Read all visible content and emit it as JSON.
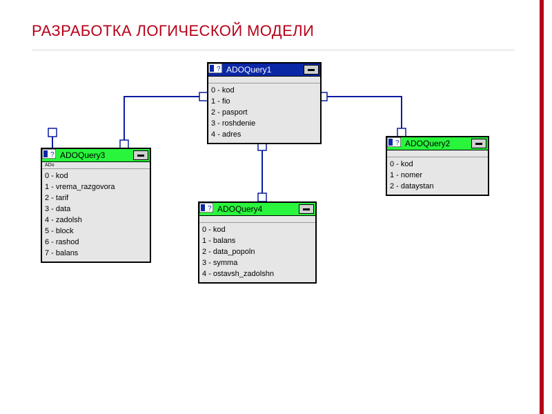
{
  "header": {
    "title": "РАЗРАБОТКА ЛОГИЧЕСКОЙ МОДЕЛИ"
  },
  "colors": {
    "accent": "#b60019",
    "header_blue": "#0a27a6",
    "header_green": "#29f53d"
  },
  "tables": {
    "q1": {
      "title": "ADOQuery1",
      "sublabel": "",
      "header_style": "blue",
      "fields": [
        {
          "index": "0",
          "name": "kod"
        },
        {
          "index": "1",
          "name": "fio"
        },
        {
          "index": "2",
          "name": "pasport"
        },
        {
          "index": "3",
          "name": "roshdenie"
        },
        {
          "index": "4",
          "name": "adres"
        }
      ]
    },
    "q2": {
      "title": "ADOQuery2",
      "sublabel": "",
      "header_style": "green",
      "fields": [
        {
          "index": "0",
          "name": "kod"
        },
        {
          "index": "1",
          "name": "nomer"
        },
        {
          "index": "2",
          "name": "dataystan"
        }
      ]
    },
    "q3": {
      "title": "ADOQuery3",
      "sublabel": "ADo",
      "header_style": "green",
      "fields": [
        {
          "index": "0",
          "name": "kod"
        },
        {
          "index": "1",
          "name": "vrema_razgovora"
        },
        {
          "index": "2",
          "name": "tarif"
        },
        {
          "index": "3",
          "name": "data"
        },
        {
          "index": "4",
          "name": "zadolsh"
        },
        {
          "index": "5",
          "name": "block"
        },
        {
          "index": "6",
          "name": "rashod"
        },
        {
          "index": "7",
          "name": "balans"
        }
      ]
    },
    "q4": {
      "title": "ADOQuery4",
      "sublabel": "",
      "header_style": "green",
      "fields": [
        {
          "index": "0",
          "name": "kod"
        },
        {
          "index": "1",
          "name": "balans"
        },
        {
          "index": "2",
          "name": "data_popoln"
        },
        {
          "index": "3",
          "name": "symma"
        },
        {
          "index": "4",
          "name": "ostavsh_zadolshn"
        }
      ]
    }
  },
  "chart_data": {
    "type": "table",
    "description": "ER-style logical data model diagram with four ADOQuery tables and 1-to-many style relations",
    "entities": [
      {
        "id": "ADOQuery1",
        "fields": [
          "kod",
          "fio",
          "pasport",
          "roshdenie",
          "adres"
        ]
      },
      {
        "id": "ADOQuery2",
        "fields": [
          "kod",
          "nomer",
          "dataystan"
        ]
      },
      {
        "id": "ADOQuery3",
        "fields": [
          "kod",
          "vrema_razgovora",
          "tarif",
          "data",
          "zadolsh",
          "block",
          "rashod",
          "balans"
        ]
      },
      {
        "id": "ADOQuery4",
        "fields": [
          "kod",
          "balans",
          "data_popoln",
          "symma",
          "ostavsh_zadolshn"
        ]
      }
    ],
    "relations": [
      {
        "from": "ADOQuery1",
        "to": "ADOQuery3"
      },
      {
        "from": "ADOQuery1",
        "to": "ADOQuery2"
      },
      {
        "from": "ADOQuery1",
        "to": "ADOQuery4"
      }
    ]
  }
}
